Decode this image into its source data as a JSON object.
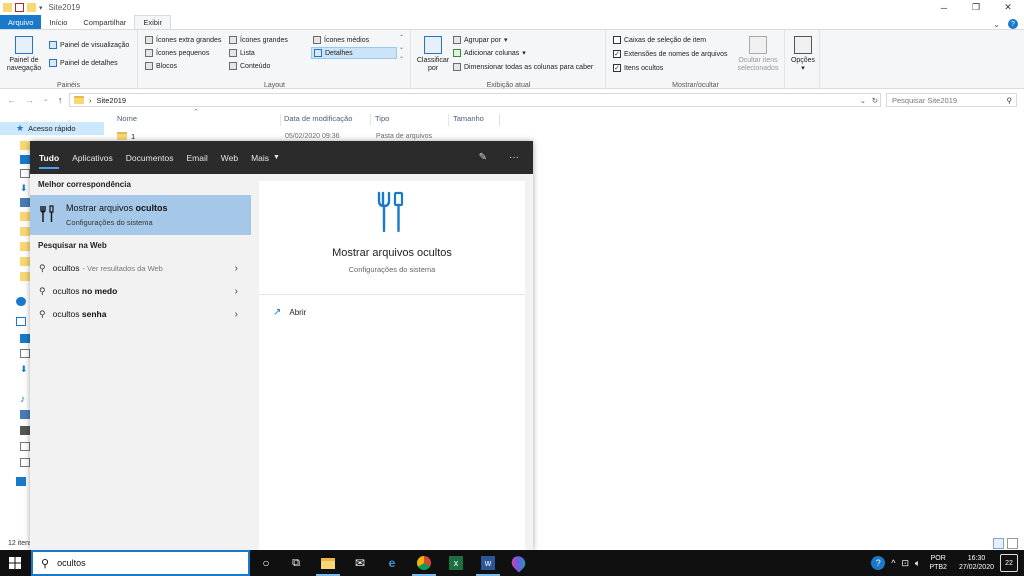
{
  "window": {
    "title": "Site2019",
    "tabs": [
      "Arquivo",
      "Início",
      "Compartilhar",
      "Exibir"
    ]
  },
  "ribbon": {
    "paineis": {
      "label": "Painéis",
      "nav_pane": "Painel de navegação",
      "preview": "Painel de visualização",
      "details": "Painel de detalhes"
    },
    "layout": {
      "label": "Layout",
      "items": [
        "Ícones extra grandes",
        "Ícones grandes",
        "Ícones médios",
        "Ícones pequenos",
        "Lista",
        "Detalhes",
        "Blocos",
        "Conteúdo"
      ],
      "selected": "Detalhes"
    },
    "exibicao_atual": {
      "label": "Exibição atual",
      "sort_by": "Classificar por",
      "group_by": "Agrupar por",
      "add_columns": "Adicionar colunas",
      "size_columns": "Dimensionar todas as colunas para caber"
    },
    "mostrar_ocultar": {
      "label": "Mostrar/ocultar",
      "checkboxes": [
        {
          "label": "Caixas de seleção de item",
          "checked": false
        },
        {
          "label": "Extensões de nomes de arquivos",
          "checked": true
        },
        {
          "label": "Itens ocultos",
          "checked": true
        }
      ],
      "hide_selected": "Ocultar itens selecionados"
    },
    "options": "Opções"
  },
  "address": {
    "path": "Site2019",
    "search_placeholder": "Pesquisar Site2019"
  },
  "navpane": {
    "quick_access": "Acesso rápido"
  },
  "filelist": {
    "columns": [
      "Nome",
      "Data de modificação",
      "Tipo",
      "Tamanho"
    ],
    "rows": [
      {
        "name": "1",
        "date": "05/02/2020 09:36",
        "type": "Pasta de arquivos"
      }
    ]
  },
  "status": {
    "items": "12 itens"
  },
  "search": {
    "tabs": [
      "Tudo",
      "Aplicativos",
      "Documentos",
      "Email",
      "Web",
      "Mais"
    ],
    "best_match_header": "Melhor correspondência",
    "best_match": {
      "title_prefix": "Mostrar arquivos ",
      "title_bold": "ocultos",
      "subtitle": "Configurações do sistema"
    },
    "web_header": "Pesquisar na Web",
    "web_results": [
      {
        "prefix": "ocultos",
        "bold": "",
        "suffix": " - Ver resultados da Web"
      },
      {
        "prefix": "ocultos ",
        "bold": "no medo",
        "suffix": ""
      },
      {
        "prefix": "ocultos ",
        "bold": "senha",
        "suffix": ""
      }
    ],
    "detail": {
      "title": "Mostrar arquivos ocultos",
      "subtitle": "Configurações do sistema",
      "open": "Abrir"
    },
    "query": "ocultos"
  },
  "taskbar": {
    "lang": "POR",
    "layout": "PTB2",
    "time": "16:30",
    "date": "27/02/2020",
    "notifications": "22"
  },
  "colors": {
    "accent": "#1979ca",
    "selection": "#a6c8e8",
    "taskbar": "#101010",
    "flyout_header": "#2b2b2b"
  }
}
